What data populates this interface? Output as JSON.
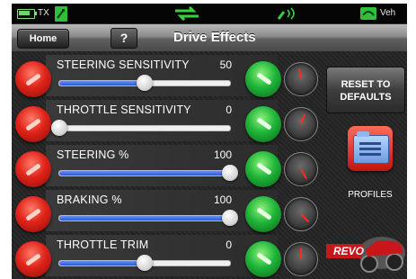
{
  "status_bar": {
    "tx_label": "TX",
    "veh_label": "Veh",
    "accent_color": "#3ad63a"
  },
  "header": {
    "home_label": "Home",
    "help_label": "?",
    "title": "Drive Effects"
  },
  "rows": [
    {
      "label": "STEERING SENSITIVITY",
      "value": "50",
      "value_color": "#ffffff"
    },
    {
      "label": "THROTTLE SENSITIVITY",
      "value": "0"
    },
    {
      "label": "STEERING %",
      "value": "100"
    },
    {
      "label": "BRAKING %",
      "value": "100"
    },
    {
      "label": "THROTTLE TRIM",
      "value": "0"
    }
  ],
  "slider_levels": [
    0.5,
    0.0,
    1.0,
    1.0,
    0.5
  ],
  "gauge_angles": [
    -10,
    20,
    150,
    135,
    0
  ],
  "right_panel": {
    "reset_label_line1": "RESET TO",
    "reset_label_line2": "DEFAULTS",
    "profiles_label": "PROFILES",
    "logo_text": "REVO"
  },
  "colors": {
    "decrease": "#e0241a",
    "increase": "#1fb63a",
    "slider_fill": "#2c58d8"
  }
}
